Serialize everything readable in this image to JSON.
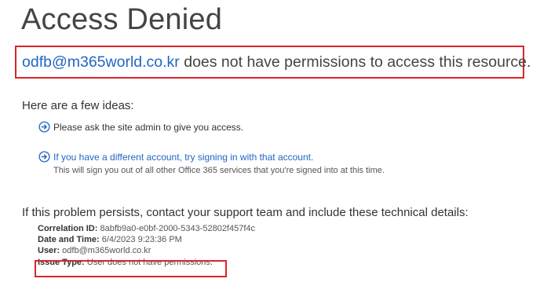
{
  "page": {
    "title": "Access Denied"
  },
  "message": {
    "account": "odfb@m365world.co.kr",
    "text": " does not have permissions to access this resource."
  },
  "ideas": {
    "heading": "Here are a few ideas:",
    "items": [
      {
        "icon": "circle-arrow-right-icon",
        "label": "Please ask the site admin to give you access.",
        "is_link": false
      },
      {
        "icon": "circle-arrow-right-icon",
        "label": "If you have a different account, try signing in with that account.",
        "is_link": true,
        "subtext": "This will sign you out of all other Office 365 services that you're signed into at this time."
      }
    ]
  },
  "support": {
    "text": "If this problem persists, contact your support team and include these technical details:"
  },
  "details": {
    "correlation_label": "Correlation ID:",
    "correlation_value": " 8abfb9a0-e0bf-2000-5343-52802f457f4c",
    "datetime_label": "Date and Time:",
    "datetime_value": " 6/4/2023 9:23:36 PM",
    "user_label": "User:",
    "user_value": " odfb@m365world.co.kr",
    "issue_label": "Issue Type:",
    "issue_value": " User does not have permissions."
  },
  "colors": {
    "link": "#2266c4",
    "highlight_border": "#d9252b",
    "text": "#333333"
  }
}
